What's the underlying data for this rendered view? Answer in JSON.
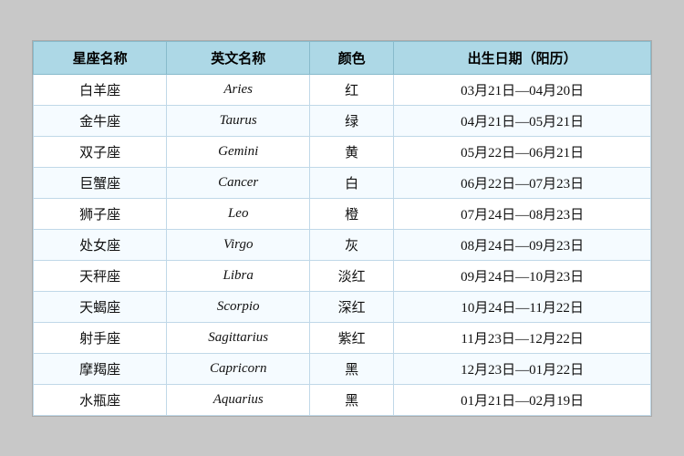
{
  "table": {
    "headers": [
      "星座名称",
      "英文名称",
      "颜色",
      "出生日期（阳历）"
    ],
    "rows": [
      {
        "zh": "白羊座",
        "en": "Aries",
        "color": "红",
        "dates": "03月21日—04月20日"
      },
      {
        "zh": "金牛座",
        "en": "Taurus",
        "color": "绿",
        "dates": "04月21日—05月21日"
      },
      {
        "zh": "双子座",
        "en": "Gemini",
        "color": "黄",
        "dates": "05月22日—06月21日"
      },
      {
        "zh": "巨蟹座",
        "en": "Cancer",
        "color": "白",
        "dates": "06月22日—07月23日"
      },
      {
        "zh": "狮子座",
        "en": "Leo",
        "color": "橙",
        "dates": "07月24日—08月23日"
      },
      {
        "zh": "处女座",
        "en": "Virgo",
        "color": "灰",
        "dates": "08月24日—09月23日"
      },
      {
        "zh": "天秤座",
        "en": "Libra",
        "color": "淡红",
        "dates": "09月24日—10月23日"
      },
      {
        "zh": "天蝎座",
        "en": "Scorpio",
        "color": "深红",
        "dates": "10月24日—11月22日"
      },
      {
        "zh": "射手座",
        "en": "Sagittarius",
        "color": "紫红",
        "dates": "11月23日—12月22日"
      },
      {
        "zh": "摩羯座",
        "en": "Capricorn",
        "color": "黑",
        "dates": "12月23日—01月22日"
      },
      {
        "zh": "水瓶座",
        "en": "Aquarius",
        "color": "黑",
        "dates": "01月21日—02月19日"
      }
    ]
  }
}
